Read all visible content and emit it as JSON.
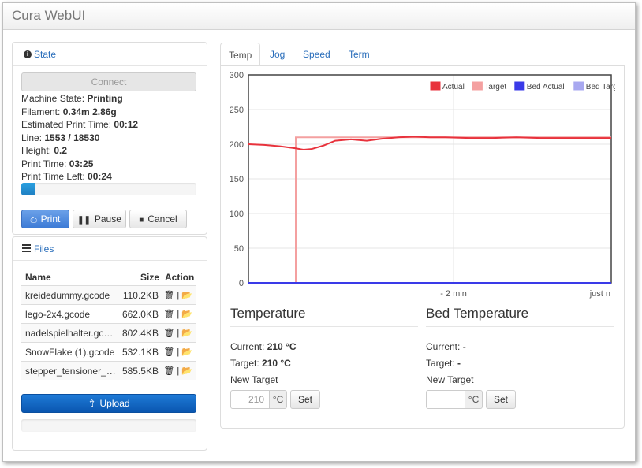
{
  "app": {
    "title": "Cura WebUI"
  },
  "state": {
    "title": "State",
    "connect_label": "Connect",
    "machine_state_label": "Machine State:",
    "machine_state": "Printing",
    "filament_label": "Filament:",
    "filament": "0.34m 2.86g",
    "est_time_label": "Estimated Print Time:",
    "est_time": "00:12",
    "line_label": "Line:",
    "line": "1553 / 18530",
    "height_label": "Height:",
    "height": "0.2",
    "print_time_label": "Print Time:",
    "print_time": "03:25",
    "time_left_label": "Print Time Left:",
    "time_left": "00:24",
    "progress_fraction": 0.08,
    "print_label": "Print",
    "pause_label": "Pause",
    "cancel_label": "Cancel"
  },
  "files": {
    "title": "Files",
    "col_name": "Name",
    "col_size": "Size",
    "col_action": "Action",
    "rows": [
      {
        "name": "kreidedummy.gcode",
        "size": "110.2KB"
      },
      {
        "name": "lego-2x4.gcode",
        "size": "662.0KB"
      },
      {
        "name": "nadelspielhalter.gc…",
        "size": "802.4KB"
      },
      {
        "name": "SnowFlake (1).gcode",
        "size": "532.1KB"
      },
      {
        "name": "stepper_tensioner_…",
        "size": "585.5KB"
      }
    ],
    "action_sep": "|",
    "upload_label": "Upload"
  },
  "tabs": [
    "Temp",
    "Jog",
    "Speed",
    "Term"
  ],
  "active_tab": "Temp",
  "temperature": {
    "title": "Temperature",
    "current_label": "Current:",
    "current": "210 °C",
    "target_label": "Target:",
    "target": "210 °C",
    "new_target_label": "New Target",
    "placeholder": "210",
    "unit": "°C",
    "set_label": "Set"
  },
  "bed": {
    "title": "Bed Temperature",
    "current_label": "Current:",
    "current": "-",
    "target_label": "Target:",
    "target": "-",
    "new_target_label": "New Target",
    "placeholder": "",
    "unit": "°C",
    "set_label": "Set"
  },
  "chart_data": {
    "type": "line",
    "title": "",
    "xlabel": "",
    "ylabel": "",
    "ylim": [
      0,
      300
    ],
    "yticks": [
      0,
      50,
      100,
      150,
      200,
      250,
      300
    ],
    "xlim": [
      -4.6,
      0
    ],
    "xtick_labels": [
      {
        "x": -2,
        "label": "- 2 min"
      },
      {
        "x": 0,
        "label": "just n"
      }
    ],
    "grid": true,
    "legend_position": "top-right",
    "series": [
      {
        "name": "Actual",
        "color": "#e8323c",
        "x": [
          -4.6,
          -4.4,
          -4.2,
          -4.0,
          -3.9,
          -3.8,
          -3.65,
          -3.5,
          -3.3,
          -3.1,
          -2.9,
          -2.7,
          -2.5,
          -2.3,
          -2.1,
          -1.8,
          -1.5,
          -1.2,
          -0.9,
          -0.6,
          -0.3,
          0.0
        ],
        "y": [
          200,
          199,
          197,
          194,
          192,
          193,
          198,
          205,
          207,
          205,
          208,
          210,
          211,
          210,
          210,
          209,
          209,
          210,
          209,
          209,
          209,
          209
        ]
      },
      {
        "name": "Target",
        "color": "#f4a0a0",
        "x": [
          -4.6,
          -4.25,
          -4.25,
          -4.0,
          -4.0,
          0.0
        ],
        "y": [
          0,
          0,
          0,
          0,
          210,
          210
        ]
      },
      {
        "name": "Bed Actual",
        "color": "#3a3ae8",
        "x": [
          -4.6,
          0.0
        ],
        "y": [
          0,
          0
        ]
      },
      {
        "name": "Bed Target",
        "color": "#a8a8f0",
        "x": [
          -4.6,
          0.0
        ],
        "y": [
          0,
          0
        ]
      }
    ]
  }
}
